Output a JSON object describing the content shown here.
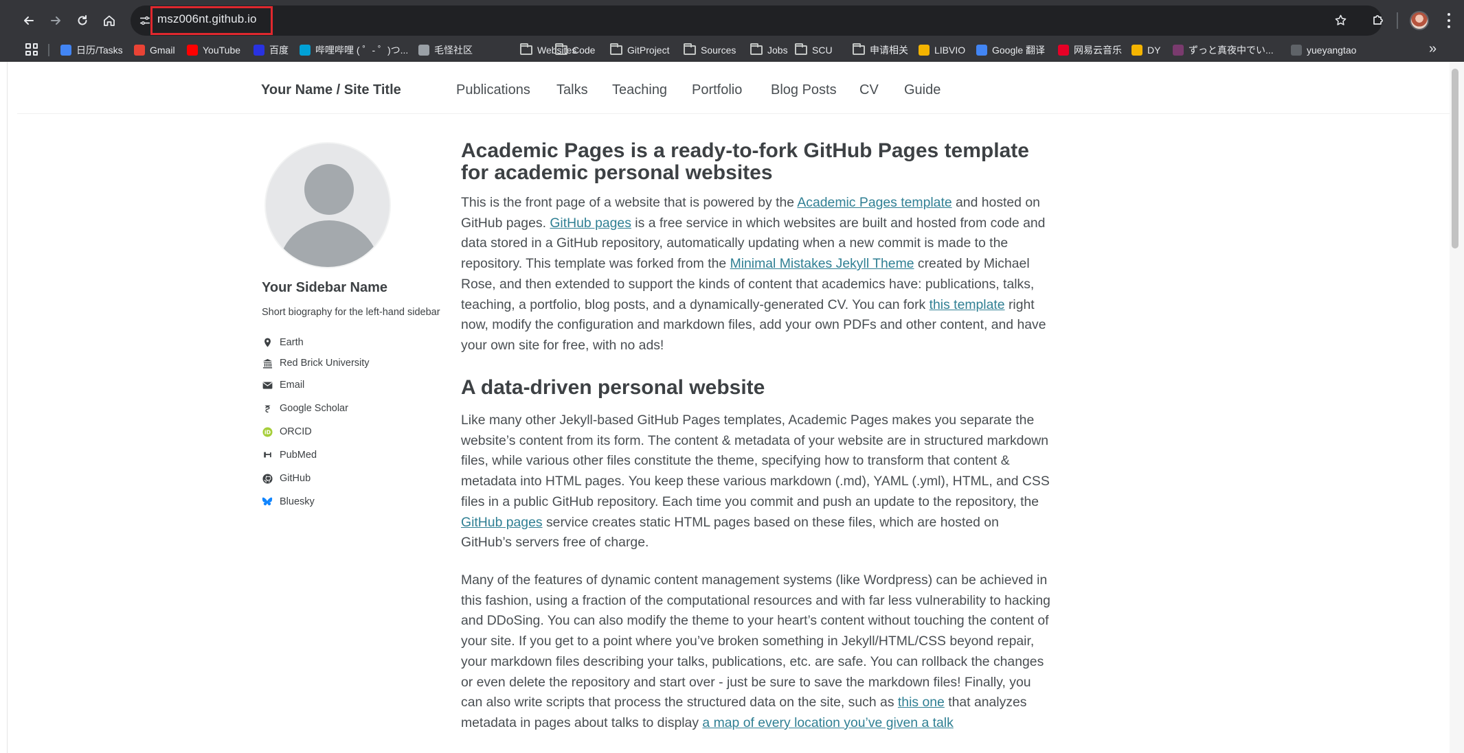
{
  "browser": {
    "url": "msz006nt.github.io",
    "bookmarks": [
      {
        "label": "日历/Tasks",
        "icon": "calendar-icon",
        "color": "#4285f4"
      },
      {
        "label": "Gmail",
        "icon": "gmail-icon",
        "color": "#ea4335"
      },
      {
        "label": "YouTube",
        "icon": "youtube-icon",
        "color": "#ff0000"
      },
      {
        "label": "百度",
        "icon": "baidu-icon",
        "color": "#2932e1"
      },
      {
        "label": "哔哩哔哩 ( ゜- ゜)つ...",
        "icon": "bilibili-icon",
        "color": "#00a1d6"
      },
      {
        "label": "毛怪社区",
        "icon": "community-icon",
        "color": "#9aa0a6"
      },
      {
        "label": "Websites",
        "icon": "folder-icon",
        "color": ""
      },
      {
        "label": "Code",
        "icon": "folder-icon",
        "color": ""
      },
      {
        "label": "GitProject",
        "icon": "folder-icon",
        "color": ""
      },
      {
        "label": "Sources",
        "icon": "folder-icon",
        "color": ""
      },
      {
        "label": "Jobs",
        "icon": "folder-icon",
        "color": ""
      },
      {
        "label": "SCU",
        "icon": "folder-icon",
        "color": ""
      },
      {
        "label": "申请相关",
        "icon": "folder-icon",
        "color": ""
      },
      {
        "label": "LIBVIO",
        "icon": "libvio-icon",
        "color": "#f4b400"
      },
      {
        "label": "Google 翻译",
        "icon": "google-translate-icon",
        "color": "#4285f4"
      },
      {
        "label": "网易云音乐",
        "icon": "netease-music-icon",
        "color": "#e60026"
      },
      {
        "label": "DY",
        "icon": "dy-icon",
        "color": "#f4b400"
      },
      {
        "label": "ずっと真夜中でい...",
        "icon": "zutomayo-icon",
        "color": "#7a3b6e"
      },
      {
        "label": "yueyangtao",
        "icon": "profile-site-icon",
        "color": "#5f6368"
      }
    ]
  },
  "site": {
    "title": "Your Name / Site Title",
    "nav": [
      "Publications",
      "Talks",
      "Teaching",
      "Portfolio",
      "Blog Posts",
      "CV",
      "Guide"
    ]
  },
  "sidebar": {
    "name": "Your Sidebar Name",
    "bio": "Short biography for the left-hand sidebar",
    "items": [
      {
        "label": "Earth",
        "icon": "location-pin-icon"
      },
      {
        "label": "Red Brick University",
        "icon": "university-icon"
      },
      {
        "label": "Email",
        "icon": "envelope-icon"
      },
      {
        "label": "Google Scholar",
        "icon": "google-scholar-icon"
      },
      {
        "label": "ORCID",
        "icon": "orcid-icon"
      },
      {
        "label": "PubMed",
        "icon": "pubmed-icon"
      },
      {
        "label": "GitHub",
        "icon": "github-icon"
      },
      {
        "label": "Bluesky",
        "icon": "bluesky-icon"
      }
    ]
  },
  "main": {
    "h1": "Academic Pages is a ready-to-fork GitHub Pages template for academic personal websites",
    "p1": {
      "t1": "This is the front page of a website that is powered by the ",
      "link1": "Academic Pages template",
      "t2": " and hosted on GitHub pages. ",
      "link2": "GitHub pages",
      "t3": " is a free service in which websites are built and hosted from code and data stored in a GitHub repository, automatically updating when a new commit is made to the repository. This template was forked from the ",
      "link3": "Minimal Mistakes Jekyll Theme",
      "t4": " created by Michael Rose, and then extended to support the kinds of content that academics have: publications, talks, teaching, a portfolio, blog posts, and a dynamically-generated CV. You can fork ",
      "link4": "this template",
      "t5": " right now, modify the configuration and markdown files, add your own PDFs and other content, and have your own site for free, with no ads!"
    },
    "h2": "A data-driven personal website",
    "p2": {
      "t1": "Like many other Jekyll-based GitHub Pages templates, Academic Pages makes you separate the website’s content from its form. The content & metadata of your website are in structured markdown files, while various other files constitute the theme, specifying how to transform that content & metadata into HTML pages. You keep these various markdown (.md), YAML (.yml), HTML, and CSS files in a public GitHub repository. Each time you commit and push an update to the repository, the ",
      "link1": "GitHub pages",
      "t2": " service creates static HTML pages based on these files, which are hosted on GitHub’s servers free of charge."
    },
    "p3": {
      "t1": "Many of the features of dynamic content management systems (like Wordpress) can be achieved in this fashion, using a fraction of the computational resources and with far less vulnerability to hacking and DDoSing. You can also modify the theme to your heart’s content without touching the content of your site. If you get to a point where you’ve broken something in Jekyll/HTML/CSS beyond repair, your markdown files describing your talks, publications, etc. are safe. You can rollback the changes or even delete the repository and start over - just be sure to save the markdown files! Finally, you can also write scripts that process the structured data on the site, such as ",
      "link1": "this one",
      "t2": " that analyzes metadata in pages about talks to display ",
      "link2": "a map of every location you’ve given a talk"
    }
  },
  "colors": {
    "chrome": "#35363a",
    "omnibox": "#202124",
    "highlight": "#e0282e",
    "link": "#2f7f93",
    "heading": "#3d4144",
    "text": "#494e52"
  }
}
